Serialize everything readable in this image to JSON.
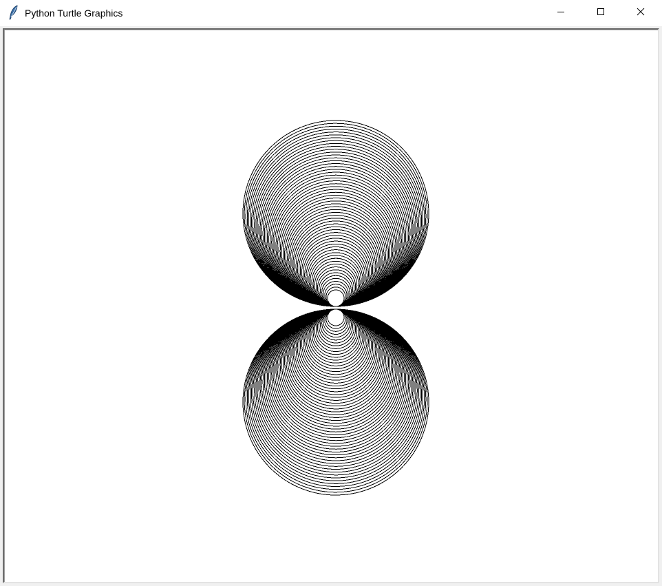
{
  "window": {
    "title": "Python Turtle Graphics",
    "app_icon": "feather-icon",
    "controls": {
      "minimize_icon": "minimize-icon",
      "maximize_icon": "maximize-icon",
      "close_icon": "close-icon"
    }
  },
  "canvas": {
    "background": "#ffffff",
    "pen_color": "#000000",
    "drawing": {
      "description_type": "turtle-circles",
      "shape_count": 2,
      "circles_per_shape": 60
    }
  }
}
